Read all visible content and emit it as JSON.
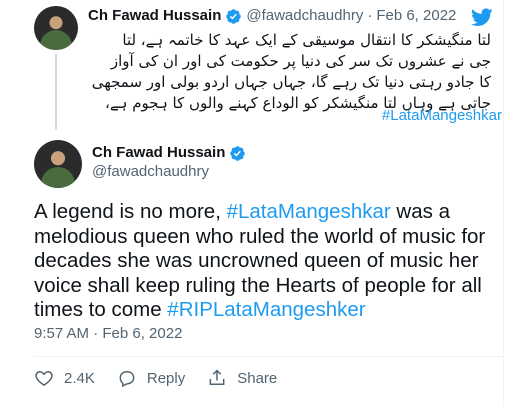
{
  "previous_tweet": {
    "author_name": "Ch Fawad Hussain",
    "handle": "@fawadchaudhry",
    "separator": "·",
    "date": "Feb 6, 2022",
    "urdu_lines": [
      "لتا منگیشکر کا انتقال موسیقی کے ایک عہد کا خاتمہ ہے، لتا",
      "جی نے عشروں تک سر کی دنیا پر حکومت کی اور ان کی آواز",
      "کا جادو رہتی دنیا تک رہے گا، جہاں جہاں اردو بولی اور سمجھی",
      "جاتی ہے وہاں لتا منگیشکر کو الوداع کہنے والوں کا ہجوم ہے،"
    ],
    "hashtag": "#LataMangeshkar"
  },
  "tweet": {
    "author_name": "Ch Fawad Hussain",
    "handle": "@fawadchaudhry",
    "text_1": "A legend is no more, ",
    "hashtag_1": "#LataMangeshkar",
    "text_2": " was a melodious queen who ruled the world of music for decades she was uncrowned queen of music her voice shall keep ruling the Hearts of people for all times to come ",
    "hashtag_2": "#RIPLataMangeshker",
    "timestamp": "9:57 AM · Feb 6, 2022"
  },
  "actions": {
    "like_count": "2.4K",
    "reply_label": "Reply",
    "share_label": "Share"
  },
  "colors": {
    "accent": "#1d9bf0",
    "secondary_text": "#536471",
    "primary_text": "#0f1419"
  }
}
